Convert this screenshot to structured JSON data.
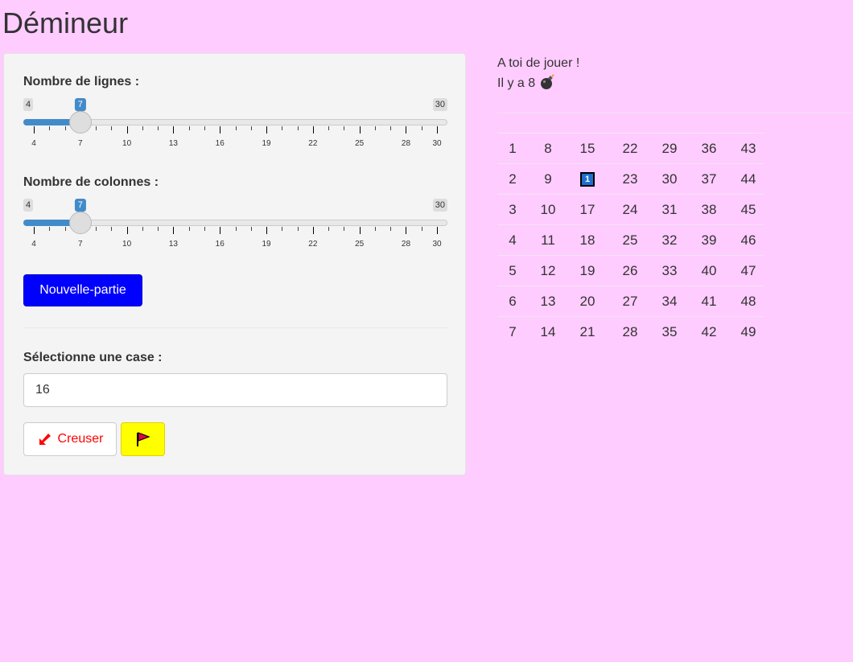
{
  "title": "Démineur",
  "sliders": [
    {
      "label": "Nombre de lignes :",
      "min": 4,
      "max": 30,
      "value": 7,
      "tick_labels": [
        "4",
        "7",
        "10",
        "13",
        "16",
        "19",
        "22",
        "25",
        "28",
        "30"
      ]
    },
    {
      "label": "Nombre de colonnes :",
      "min": 4,
      "max": 30,
      "value": 7,
      "tick_labels": [
        "4",
        "7",
        "10",
        "13",
        "16",
        "19",
        "22",
        "25",
        "28",
        "30"
      ]
    }
  ],
  "new_game_label": "Nouvelle-partie",
  "select_label": "Sélectionne une case :",
  "select_value": "16",
  "dig_label": "Creuser",
  "status": {
    "line1": "A toi de jouer !",
    "line2": "Il y a 8",
    "bomb_icon": "bomb-icon"
  },
  "grid": [
    [
      "1",
      "8",
      "15",
      "22",
      "29",
      "36",
      "43"
    ],
    [
      "2",
      "9",
      "1",
      "23",
      "30",
      "37",
      "44"
    ],
    [
      "3",
      "10",
      "17",
      "24",
      "31",
      "38",
      "45"
    ],
    [
      "4",
      "11",
      "18",
      "25",
      "32",
      "39",
      "46"
    ],
    [
      "5",
      "12",
      "19",
      "26",
      "33",
      "40",
      "47"
    ],
    [
      "6",
      "13",
      "20",
      "27",
      "34",
      "41",
      "48"
    ],
    [
      "7",
      "14",
      "21",
      "28",
      "35",
      "42",
      "49"
    ]
  ],
  "revealed_cells": [
    {
      "row": 1,
      "col": 2,
      "value": "1"
    }
  ],
  "colors": {
    "background": "#ffccff",
    "new_game": "#0000ff",
    "flag_button": "#ffff00",
    "dig_text": "#ff0000",
    "slider": "#428bca"
  }
}
